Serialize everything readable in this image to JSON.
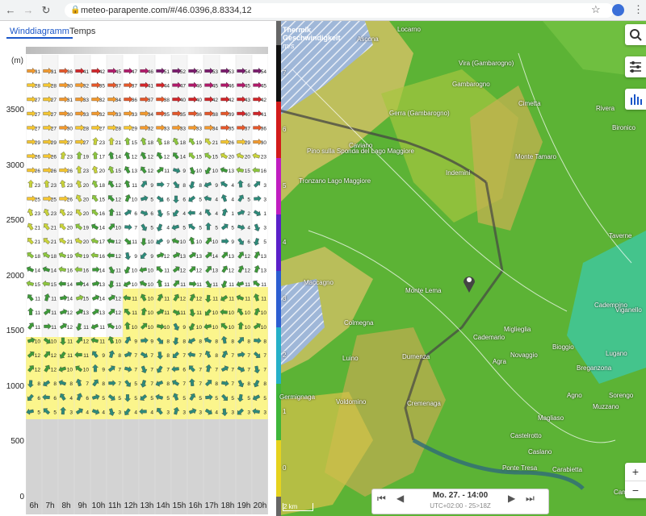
{
  "browser": {
    "url": "meteo-parapente.com/#/46.0396,8.8334,12"
  },
  "tabs": [
    "Winddiagramm",
    "Temps"
  ],
  "diagram": {
    "y_unit": "(m)",
    "y_ticks": [
      "3500",
      "3000",
      "2500",
      "2000",
      "1500",
      "1000",
      "500",
      "0"
    ],
    "hours": [
      "6h",
      "7h",
      "8h",
      "9h",
      "10h",
      "11h",
      "12h",
      "13h",
      "14h",
      "15h",
      "16h",
      "17h",
      "18h",
      "19h",
      "20h"
    ],
    "rows": [
      [
        "31",
        "31",
        "36",
        "41",
        "42",
        "45",
        "47",
        "46",
        "51",
        "52",
        "50",
        "53",
        "53",
        "54",
        "54"
      ],
      [
        "28",
        "28",
        "30",
        "32",
        "35",
        "37",
        "37",
        "41",
        "44",
        "47",
        "46",
        "45",
        "46",
        "45",
        "45"
      ],
      [
        "27",
        "27",
        "31",
        "33",
        "32",
        "34",
        "36",
        "37",
        "38",
        "40",
        "40",
        "42",
        "42",
        "43",
        "42"
      ],
      [
        "27",
        "27",
        "30",
        "33",
        "32",
        "33",
        "33",
        "34",
        "35",
        "35",
        "36",
        "38",
        "39",
        "40",
        "41"
      ],
      [
        "27",
        "27",
        "30",
        "28",
        "27",
        "28",
        "29",
        "32",
        "33",
        "33",
        "33",
        "34",
        "35",
        "37",
        "36"
      ],
      [
        "29",
        "29",
        "27",
        "27",
        "23",
        "21",
        "15",
        "18",
        "18",
        "18",
        "19",
        "21",
        "26",
        "29",
        "30"
      ],
      [
        "26",
        "26",
        "23",
        "19",
        "17",
        "14",
        "12",
        "12",
        "12",
        "14",
        "15",
        "15",
        "20",
        "20",
        "23"
      ],
      [
        "26",
        "26",
        "26",
        "23",
        "20",
        "15",
        "13",
        "12",
        "11",
        "9",
        "10",
        "10",
        "13",
        "15",
        "16"
      ],
      [
        "23",
        "23",
        "23",
        "20",
        "18",
        "12",
        "11",
        "9",
        "7",
        "8",
        "8",
        "9",
        "4",
        "6",
        "3"
      ],
      [
        "25",
        "25",
        "26",
        "20",
        "15",
        "12",
        "10",
        "5",
        "6",
        "6",
        "5",
        "4",
        "4",
        "5",
        "3"
      ],
      [
        "23",
        "23",
        "22",
        "20",
        "16",
        "11",
        "6",
        "6",
        "5",
        "4",
        "4",
        "4",
        "1",
        "2",
        "1"
      ],
      [
        "21",
        "21",
        "20",
        "19",
        "14",
        "10",
        "7",
        "5",
        "4",
        "5",
        "5",
        "5",
        "5",
        "4",
        "3"
      ],
      [
        "21",
        "21",
        "21",
        "20",
        "17",
        "12",
        "11",
        "10",
        "9",
        "10",
        "10",
        "10",
        "9",
        "6",
        "5"
      ],
      [
        "18",
        "18",
        "19",
        "19",
        "16",
        "12",
        "9",
        "9",
        "12",
        "13",
        "13",
        "14",
        "13",
        "12",
        "13"
      ],
      [
        "14",
        "14",
        "16",
        "16",
        "14",
        "11",
        "10",
        "10",
        "11",
        "12",
        "12",
        "13",
        "12",
        "12",
        "13"
      ],
      [
        "15",
        "15",
        "14",
        "14",
        "13",
        "11",
        "10",
        "10",
        "11",
        "11",
        "11",
        "11",
        "11",
        "11",
        "11"
      ],
      [
        "11",
        "11",
        "14",
        "15",
        "14",
        "12",
        "11",
        "10",
        "11",
        "12",
        "12",
        "11",
        "11",
        "11",
        "11"
      ],
      [
        "11",
        "11",
        "12",
        "13",
        "13",
        "12",
        "11",
        "10",
        "11",
        "11",
        "11",
        "10",
        "10",
        "10",
        "10"
      ],
      [
        "11",
        "11",
        "12",
        "11",
        "11",
        "10",
        "10",
        "10",
        "10",
        "9",
        "10",
        "10",
        "10",
        "10",
        "10"
      ],
      [
        "10",
        "10",
        "11",
        "12",
        "11",
        "10",
        "9",
        "9",
        "8",
        "8",
        "8",
        "8",
        "8",
        "8",
        "8"
      ],
      [
        "12",
        "12",
        "11",
        "11",
        "9",
        "8",
        "7",
        "7",
        "8",
        "7",
        "7",
        "8",
        "7",
        "7",
        "7"
      ],
      [
        "12",
        "12",
        "10",
        "10",
        "9",
        "7",
        "7",
        "7",
        "7",
        "6",
        "7",
        "7",
        "7",
        "7",
        "7"
      ],
      [
        "8",
        "8",
        "8",
        "7",
        "8",
        "7",
        "5",
        "7",
        "8",
        "7",
        "7",
        "8",
        "7",
        "8",
        "8"
      ],
      [
        "6",
        "6",
        "4",
        "6",
        "5",
        "5",
        "5",
        "5",
        "5",
        "5",
        "5",
        "5",
        "5",
        "5",
        "5"
      ],
      [
        "5",
        "5",
        "3",
        "4",
        "4",
        "3",
        "4",
        "4",
        "3",
        "3",
        "3",
        "4",
        "3",
        "3",
        "3"
      ]
    ]
  },
  "map": {
    "legend_title": "Thermik Geschwindigkeit",
    "legend_unit": "m/s",
    "scale_ticks": [
      "7",
      "6",
      "5",
      "4",
      "3",
      "2",
      "1",
      "0"
    ],
    "labels": [
      "Ascona",
      "Locarno",
      "Vira (Gambarogno)",
      "Gambarogno",
      "Cimetta",
      "Gerra (Gambarogno)",
      "Caviano",
      "Pino sulla Sponda del Lago Maggiore",
      "Indemini",
      "Monte Tamaro",
      "Tronzano Lago Maggiore",
      "Maccagno",
      "Monte Lema",
      "Miglieglia",
      "Rivera",
      "Bironico",
      "Taverne",
      "Colmegna",
      "Luino",
      "Germignaga",
      "Dumenza",
      "Agra",
      "Novaggio",
      "Bioggio",
      "Lugano",
      "Cadempino",
      "Breganzona",
      "Viganello",
      "Voldomino",
      "Cremenaga",
      "Ponte Tresa",
      "Castelrotto",
      "Caslano",
      "Magliaso",
      "Agno",
      "Muzzano",
      "Carabietta",
      "Campione",
      "Cademario",
      "Sorengo"
    ],
    "scale_label": "2 km",
    "time_label": "Mo. 27. - 14:00",
    "timezone_label": "UTC+02:00 - 25>18Z"
  }
}
